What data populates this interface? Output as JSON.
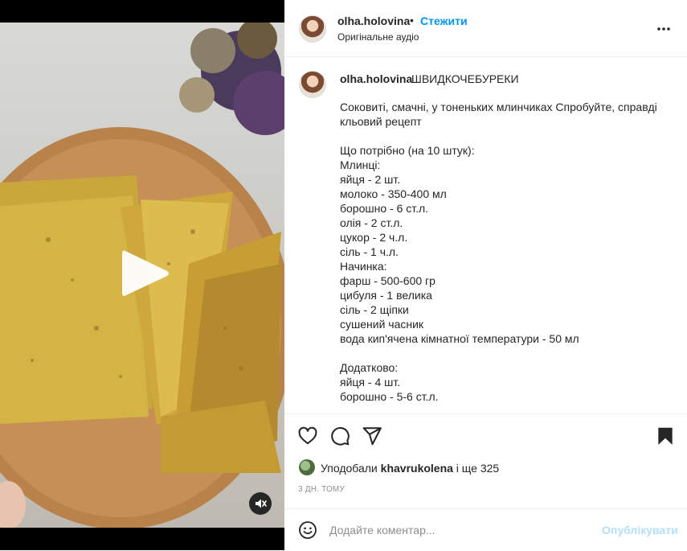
{
  "media": {
    "play_icon": "play-icon",
    "mute_icon": "speaker-muted-icon"
  },
  "header": {
    "username": "olha.holovina",
    "separator": "•",
    "follow_label": "Стежити",
    "audio_label": "Оригінальне аудіо",
    "more_icon": "more-horizontal-icon"
  },
  "caption": {
    "username": "olha.holovina",
    "title": "ШВИДКОЧЕБУРЕКИ",
    "lines": [
      "Соковиті, смачні, у тоненьких млинчиках Спробуйте, справді",
      "кльовий рецепт",
      "",
      "Що потрібно (на 10 штук):",
      "Млинці:",
      "яйця - 2 шт.",
      "молоко - 350-400 мл",
      "борошно - 6 ст.л.",
      "олія - 2 ст.л.",
      "цукор - 2 ч.л.",
      "сіль - 1 ч.л.",
      "Начинка:",
      "фарш - 500-600 гр",
      "цибуля - 1 велика",
      "сіль - 2 щіпки",
      "сушений часник",
      "вода кип'ячена кімнатної температури - 50 мл",
      "",
      "Додатково:",
      "яйця - 4 шт.",
      "борошно - 5-6 ст.л."
    ]
  },
  "actions": {
    "like_icon": "heart-icon",
    "comment_icon": "comment-icon",
    "share_icon": "share-icon",
    "save_icon": "bookmark-icon"
  },
  "likes": {
    "prefix": "Уподобали ",
    "user": "khavrukolena",
    "suffix": " і ще 325"
  },
  "time": "3 ДН. ТОМУ",
  "comment": {
    "placeholder": "Додайте коментар...",
    "publish_label": "Опублікувати",
    "emoji_icon": "emoji-icon"
  },
  "colors": {
    "link_blue": "#0095f6",
    "publish_disabled": "#b2dffc",
    "muted_text": "#8e8e8e",
    "divider": "#efefef"
  }
}
